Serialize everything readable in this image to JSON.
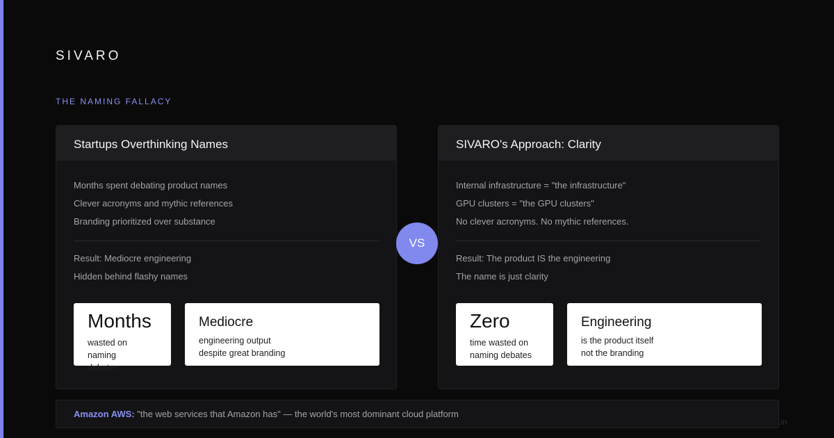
{
  "brand": "SIVARO",
  "kicker": "THE NAMING FALLACY",
  "left_card": {
    "title": "Startups Overthinking Names",
    "lines": [
      "Months spent debating product names",
      "Clever acronyms and mythic references",
      "Branding prioritized over substance"
    ],
    "result_lines": [
      "Result: Mediocre engineering",
      "Hidden behind flashy names"
    ],
    "stat_small": {
      "value": "Months",
      "sub1": "wasted on naming",
      "sub2": "debates"
    },
    "stat_large": {
      "value": "Mediocre",
      "sub1": "engineering output",
      "sub2": "despite great branding"
    }
  },
  "right_card": {
    "title": "SIVARO's Approach: Clarity",
    "lines": [
      "Internal infrastructure = \"the infrastructure\"",
      "GPU clusters = \"the GPU clusters\"",
      "No clever acronyms. No mythic references."
    ],
    "result_lines": [
      "Result: The product IS the engineering",
      "The name is just clarity"
    ],
    "stat_small": {
      "value": "Zero",
      "sub1": "time wasted on",
      "sub2": "naming debates"
    },
    "stat_large": {
      "value": "Engineering",
      "sub1": "is the product itself",
      "sub2": "not the branding"
    }
  },
  "vs_label": "VS",
  "footer": {
    "highlight": "Amazon AWS:",
    "text": " \"the web services that Amazon has\" — the world's most dominant cloud platform"
  },
  "watermark": ".in",
  "colors": {
    "accent": "#7b82ea",
    "background": "#0a0a0b",
    "card": "#141416"
  }
}
